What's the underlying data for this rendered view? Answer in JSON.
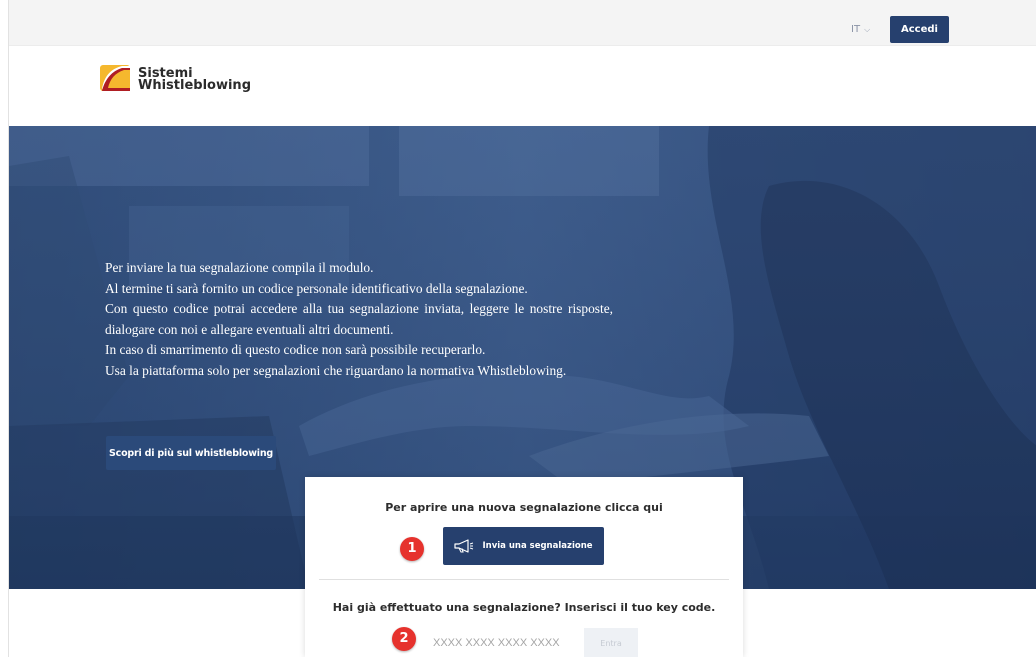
{
  "topbar": {
    "language": "IT",
    "login_label": "Accedi"
  },
  "brand": {
    "line1": "Sistemi",
    "line2": "Whistleblowing"
  },
  "hero": {
    "paragraphs": [
      "Per inviare la tua segnalazione compila il modulo.",
      "Al termine ti sarà  fornito un codice personale identificativo della segnalazione.",
      "Con questo codice potrai accedere alla tua segnalazione inviata, leggere le nostre risposte, dialogare con noi e allegare eventuali altri documenti.",
      "In caso di smarrimento di questo codice non sarà  possibile recuperarlo.",
      "Usa la piattaforma solo per segnalazioni che riguardano la normativa Whistleblowing."
    ],
    "more_button": "Scopri di più sul whistleblowing"
  },
  "card": {
    "new_title": "Per aprire una nuova segnalazione clicca qui",
    "step1_badge": "1",
    "send_button": "Invia una segnalazione",
    "existing_title": "Hai già effettuato una segnalazione? Inserisci il tuo key code.",
    "step2_badge": "2",
    "keycode_placeholder": "XXXX XXXX XXXX XXXX",
    "enter_button": "Entra"
  },
  "colors": {
    "primary": "#26406e",
    "badge": "#e6322d",
    "hero_overlay": "#2f4d7e"
  }
}
